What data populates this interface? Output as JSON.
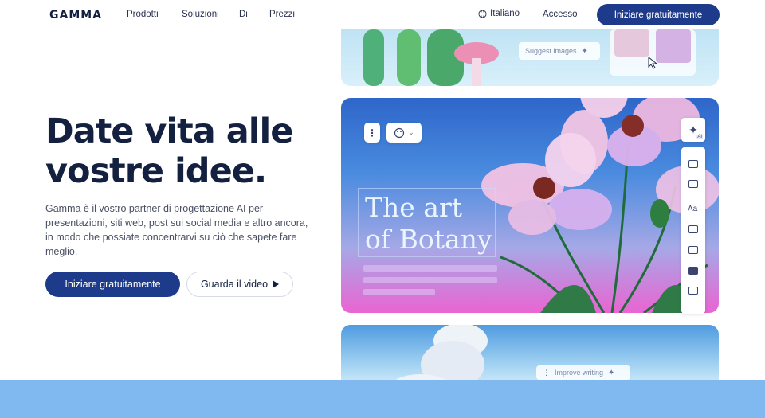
{
  "nav": {
    "logo": "GAMMA",
    "links": [
      "Prodotti",
      "Soluzioni",
      "Di",
      "Prezzi"
    ],
    "language": "Italiano",
    "login": "Accesso",
    "cta": "Iniziare gratuitamente"
  },
  "hero": {
    "title": "Date vita alle vostre idee.",
    "description": "Gamma è il vostro partner di progettazione AI per presentazioni, siti web, post sui social media e altro ancora, in modo che possiate concentrarvi su ciò che sapete fare meglio.",
    "primary_button": "Iniziare gratuitamente",
    "secondary_button": "Guarda il video"
  },
  "preview": {
    "top_pill": "Suggest images",
    "art_title_line1": "The art",
    "art_title_line2": "of Botany",
    "ai_badge": "AI",
    "bottom_pill": "Improve writing"
  },
  "colors": {
    "brand": "#1e3a8a",
    "text": "#13203f",
    "band": "#7fb9f0"
  }
}
